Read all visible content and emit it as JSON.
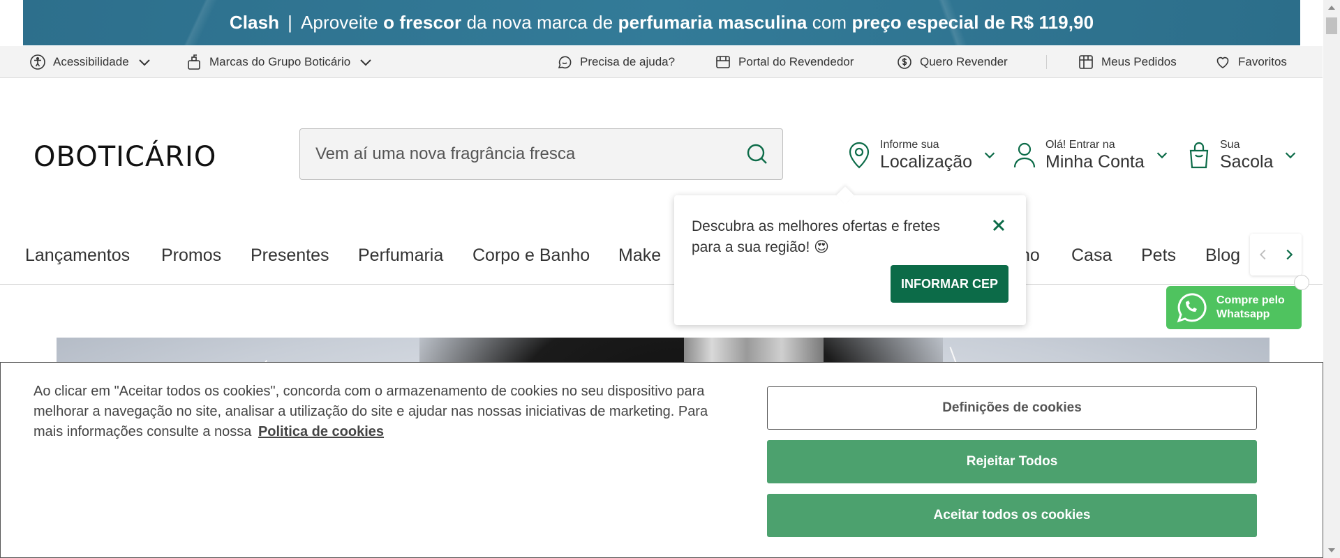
{
  "promo": {
    "brand": "Clash",
    "separator": "|",
    "t1": "Aproveite",
    "t2": "o frescor",
    "t3": "da nova marca de",
    "t4": "perfumaria masculina",
    "t5": "com",
    "t6": "preço especial de R$ 119,90"
  },
  "utility": {
    "accessibility": "Acessibilidade",
    "brands": "Marcas do Grupo Boticário",
    "help": "Precisa de ajuda?",
    "reseller_portal": "Portal do Revendedor",
    "become_reseller": "Quero Revender",
    "orders": "Meus Pedidos",
    "favorites": "Favoritos"
  },
  "header": {
    "logo_text": "OBOTICÁRIO",
    "search_placeholder": "Vem aí uma nova fragrância fresca",
    "location_small": "Informe sua",
    "location_big": "Localização",
    "account_small": "Olá! Entrar na",
    "account_big": "Minha Conta",
    "bag_small": "Sua",
    "bag_big": "Sacola"
  },
  "nav": {
    "items": [
      "Lançamentos",
      "Promos",
      "Presentes",
      "Perfumaria",
      "Corpo e Banho",
      "Make",
      "no",
      "Casa",
      "Pets",
      "Blog"
    ]
  },
  "location_popover": {
    "text": "Descubra as melhores ofertas e fretes para a sua região! 😍",
    "button": "INFORMAR CEP"
  },
  "whatsapp": {
    "line1": "Compre pelo",
    "line2": "Whatsapp"
  },
  "cookies": {
    "text": "Ao clicar em \"Aceitar todos os cookies\", concorda com o armazenamento de cookies no seu dispositivo para melhorar a navegação no site, analisar a utilização do site e ajudar nas nossas iniciativas de marketing. Para mais informações consulte a nossa",
    "policy_link": "Politica de cookies",
    "settings_button": "Definições de cookies",
    "reject_button": "Rejeitar Todos",
    "accept_button": "Aceitar todos os cookies"
  },
  "colors": {
    "brand_green": "#0c6b48",
    "cookie_green": "#4ca16e",
    "banner_blue": "#2f7593",
    "whatsapp_green": "#4fc35f"
  }
}
